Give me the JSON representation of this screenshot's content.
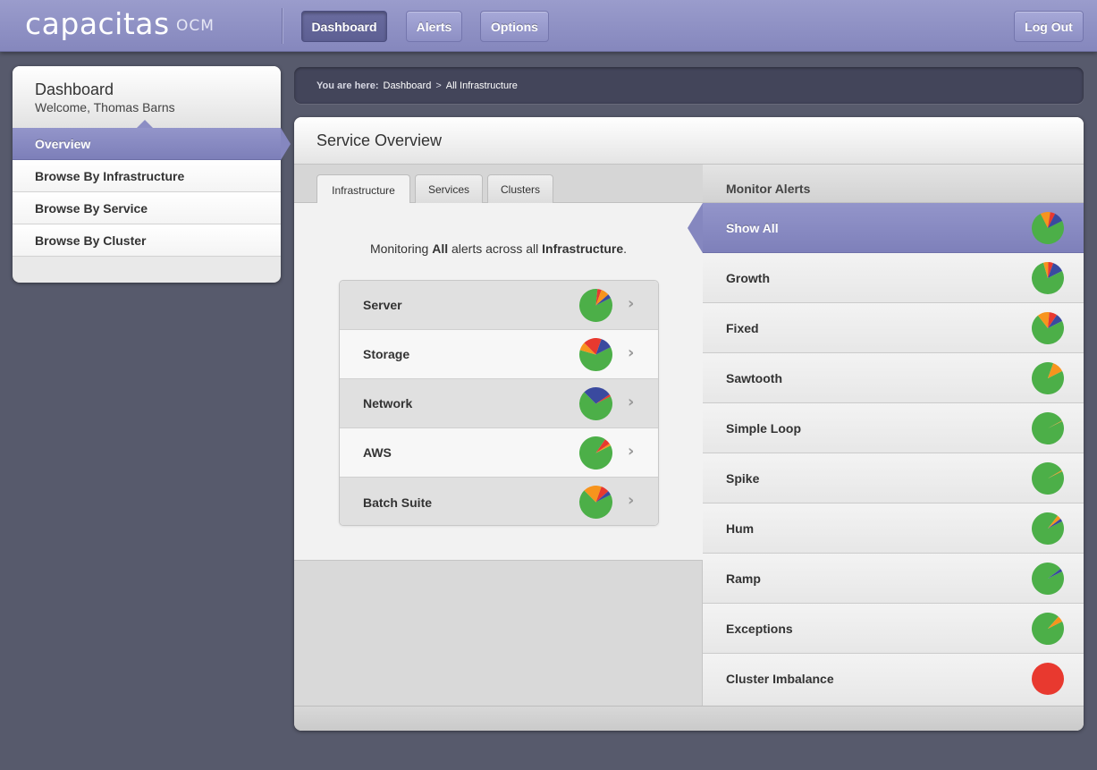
{
  "app": {
    "logo_text": "capacitas",
    "logo_sub": "OCM",
    "nav": [
      {
        "label": "Dashboard"
      },
      {
        "label": "Alerts"
      },
      {
        "label": "Options"
      }
    ],
    "logout_label": "Log Out"
  },
  "sidebar": {
    "title": "Dashboard",
    "welcome": "Welcome, Thomas Barns",
    "items": [
      {
        "label": "Overview"
      },
      {
        "label": "Browse By Infrastructure"
      },
      {
        "label": "Browse By Service"
      },
      {
        "label": "Browse By Cluster"
      }
    ]
  },
  "breadcrumb": {
    "prefix": "You are here:",
    "items": [
      "Dashboard",
      "All Infrastructure"
    ],
    "separator": ">"
  },
  "main": {
    "title": "Service Overview",
    "tabs": [
      {
        "label": "Infrastructure"
      },
      {
        "label": "Services"
      },
      {
        "label": "Clusters"
      }
    ],
    "monitoring": {
      "pre": "Monitoring ",
      "bold1": "All",
      "mid": " alerts across all ",
      "bold2": "Infrastructure",
      "post": "."
    },
    "infrastructure": [
      {
        "label": "Server",
        "slices": [
          {
            "color": "#4caf48",
            "value": 0.84
          },
          {
            "color": "#e8392f",
            "value": 0.04
          },
          {
            "color": "#f7941d",
            "value": 0.08
          },
          {
            "color": "#3a4a9f",
            "value": 0.04
          }
        ]
      },
      {
        "label": "Storage",
        "slices": [
          {
            "color": "#4caf48",
            "value": 0.62
          },
          {
            "color": "#f7941d",
            "value": 0.08
          },
          {
            "color": "#e8392f",
            "value": 0.18
          },
          {
            "color": "#3a4a9f",
            "value": 0.12
          }
        ]
      },
      {
        "label": "Network",
        "slices": [
          {
            "color": "#4caf48",
            "value": 0.7
          },
          {
            "color": "#3a4a9f",
            "value": 0.28
          },
          {
            "color": "#e8392f",
            "value": 0.02
          }
        ]
      },
      {
        "label": "AWS",
        "slices": [
          {
            "color": "#4caf48",
            "value": 0.92
          },
          {
            "color": "#e8392f",
            "value": 0.06
          },
          {
            "color": "#f7941d",
            "value": 0.02
          }
        ]
      },
      {
        "label": "Batch Suite",
        "slices": [
          {
            "color": "#4caf48",
            "value": 0.7
          },
          {
            "color": "#f7941d",
            "value": 0.18
          },
          {
            "color": "#e8392f",
            "value": 0.08
          },
          {
            "color": "#3a4a9f",
            "value": 0.04
          }
        ]
      }
    ]
  },
  "alerts": {
    "title": "Monitor Alerts",
    "items": [
      {
        "label": "Show All",
        "slices": [
          {
            "color": "#4caf48",
            "value": 0.75
          },
          {
            "color": "#f7941d",
            "value": 0.1
          },
          {
            "color": "#e8392f",
            "value": 0.05
          },
          {
            "color": "#3a4a9f",
            "value": 0.1
          }
        ]
      },
      {
        "label": "Growth",
        "slices": [
          {
            "color": "#4caf48",
            "value": 0.78
          },
          {
            "color": "#f7941d",
            "value": 0.05
          },
          {
            "color": "#e8392f",
            "value": 0.05
          },
          {
            "color": "#3a4a9f",
            "value": 0.12
          }
        ]
      },
      {
        "label": "Fixed",
        "slices": [
          {
            "color": "#4caf48",
            "value": 0.72
          },
          {
            "color": "#f7941d",
            "value": 0.12
          },
          {
            "color": "#e8392f",
            "value": 0.08
          },
          {
            "color": "#3a4a9f",
            "value": 0.08
          }
        ]
      },
      {
        "label": "Sawtooth",
        "slices": [
          {
            "color": "#4caf48",
            "value": 0.88
          },
          {
            "color": "#f7941d",
            "value": 0.12
          }
        ]
      },
      {
        "label": "Simple Loop",
        "slices": [
          {
            "color": "#4caf48",
            "value": 0.995
          },
          {
            "color": "#f7941d",
            "value": 0.005
          }
        ]
      },
      {
        "label": "Spike",
        "slices": [
          {
            "color": "#4caf48",
            "value": 0.99
          },
          {
            "color": "#f7941d",
            "value": 0.01
          }
        ]
      },
      {
        "label": "Hum",
        "slices": [
          {
            "color": "#4caf48",
            "value": 0.93
          },
          {
            "color": "#f7941d",
            "value": 0.04
          },
          {
            "color": "#3a4a9f",
            "value": 0.03
          }
        ]
      },
      {
        "label": "Ramp",
        "slices": [
          {
            "color": "#4caf48",
            "value": 0.97
          },
          {
            "color": "#3a4a9f",
            "value": 0.03
          }
        ]
      },
      {
        "label": "Exceptions",
        "slices": [
          {
            "color": "#4caf48",
            "value": 0.94
          },
          {
            "color": "#f7941d",
            "value": 0.06
          }
        ]
      },
      {
        "label": "Cluster Imbalance",
        "slices": [
          {
            "color": "#e8392f",
            "value": 1.0
          }
        ]
      }
    ]
  }
}
